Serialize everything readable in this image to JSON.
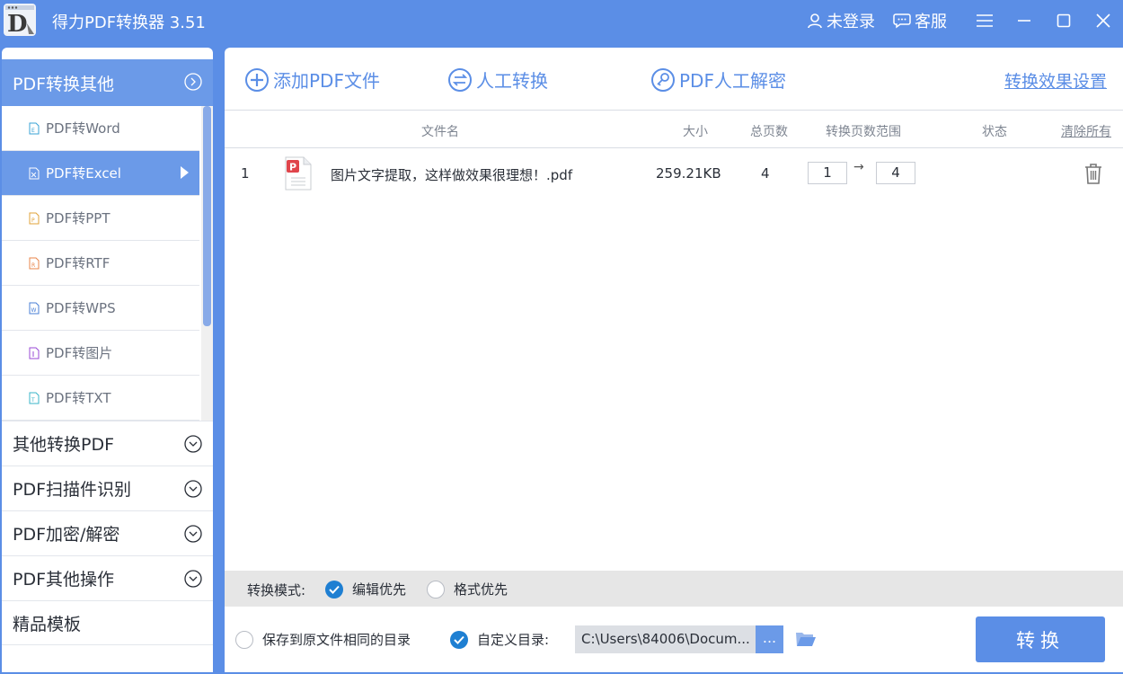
{
  "app": {
    "title": "得力PDF转换器 3.51"
  },
  "titlebar": {
    "login": "未登录",
    "service": "客服"
  },
  "sidebar": {
    "header": "PDF转换其他",
    "sub_items": [
      {
        "label": "PDF转Word",
        "icon_color": "#3aa3d6"
      },
      {
        "label": "PDF转Excel",
        "icon_color": "#ffffff"
      },
      {
        "label": "PDF转PPT",
        "icon_color": "#e0a33a"
      },
      {
        "label": "PDF转RTF",
        "icon_color": "#e8844a"
      },
      {
        "label": "PDF转WPS",
        "icon_color": "#4a7fd6"
      },
      {
        "label": "PDF转图片",
        "icon_color": "#9a4ad6"
      },
      {
        "label": "PDF转TXT",
        "icon_color": "#3ab5c9"
      }
    ],
    "sections": [
      "其他转换PDF",
      "PDF扫描件识别",
      "PDF加密/解密",
      "PDF其他操作",
      "精品模板"
    ]
  },
  "toolbar": {
    "add_pdf": "添加PDF文件",
    "manual_convert": "人工转换",
    "manual_decrypt": "PDF人工解密",
    "effect_settings": "转换效果设置"
  },
  "table": {
    "headers": {
      "filename": "文件名",
      "size": "大小",
      "pages": "总页数",
      "range": "转换页数范围",
      "status": "状态",
      "clear_all": "清除所有"
    },
    "rows": [
      {
        "index": "1",
        "filename": "图片文字提取，这样做效果很理想！.pdf",
        "size": "259.21KB",
        "pages": "4",
        "range_from": "1",
        "range_to": "4",
        "status": ""
      }
    ]
  },
  "bottom": {
    "mode_label": "转换模式:",
    "mode_edit": "编辑优先",
    "mode_format": "格式优先",
    "save_same_dir": "保存到原文件相同的目录",
    "custom_dir": "自定义目录:",
    "path": "C:\\Users\\84006\\Docum...",
    "browse": "...",
    "convert": "转换"
  },
  "colors": {
    "accent": "#5b8ee6",
    "active": "#6b9ae8",
    "check": "#1e7fd2"
  }
}
